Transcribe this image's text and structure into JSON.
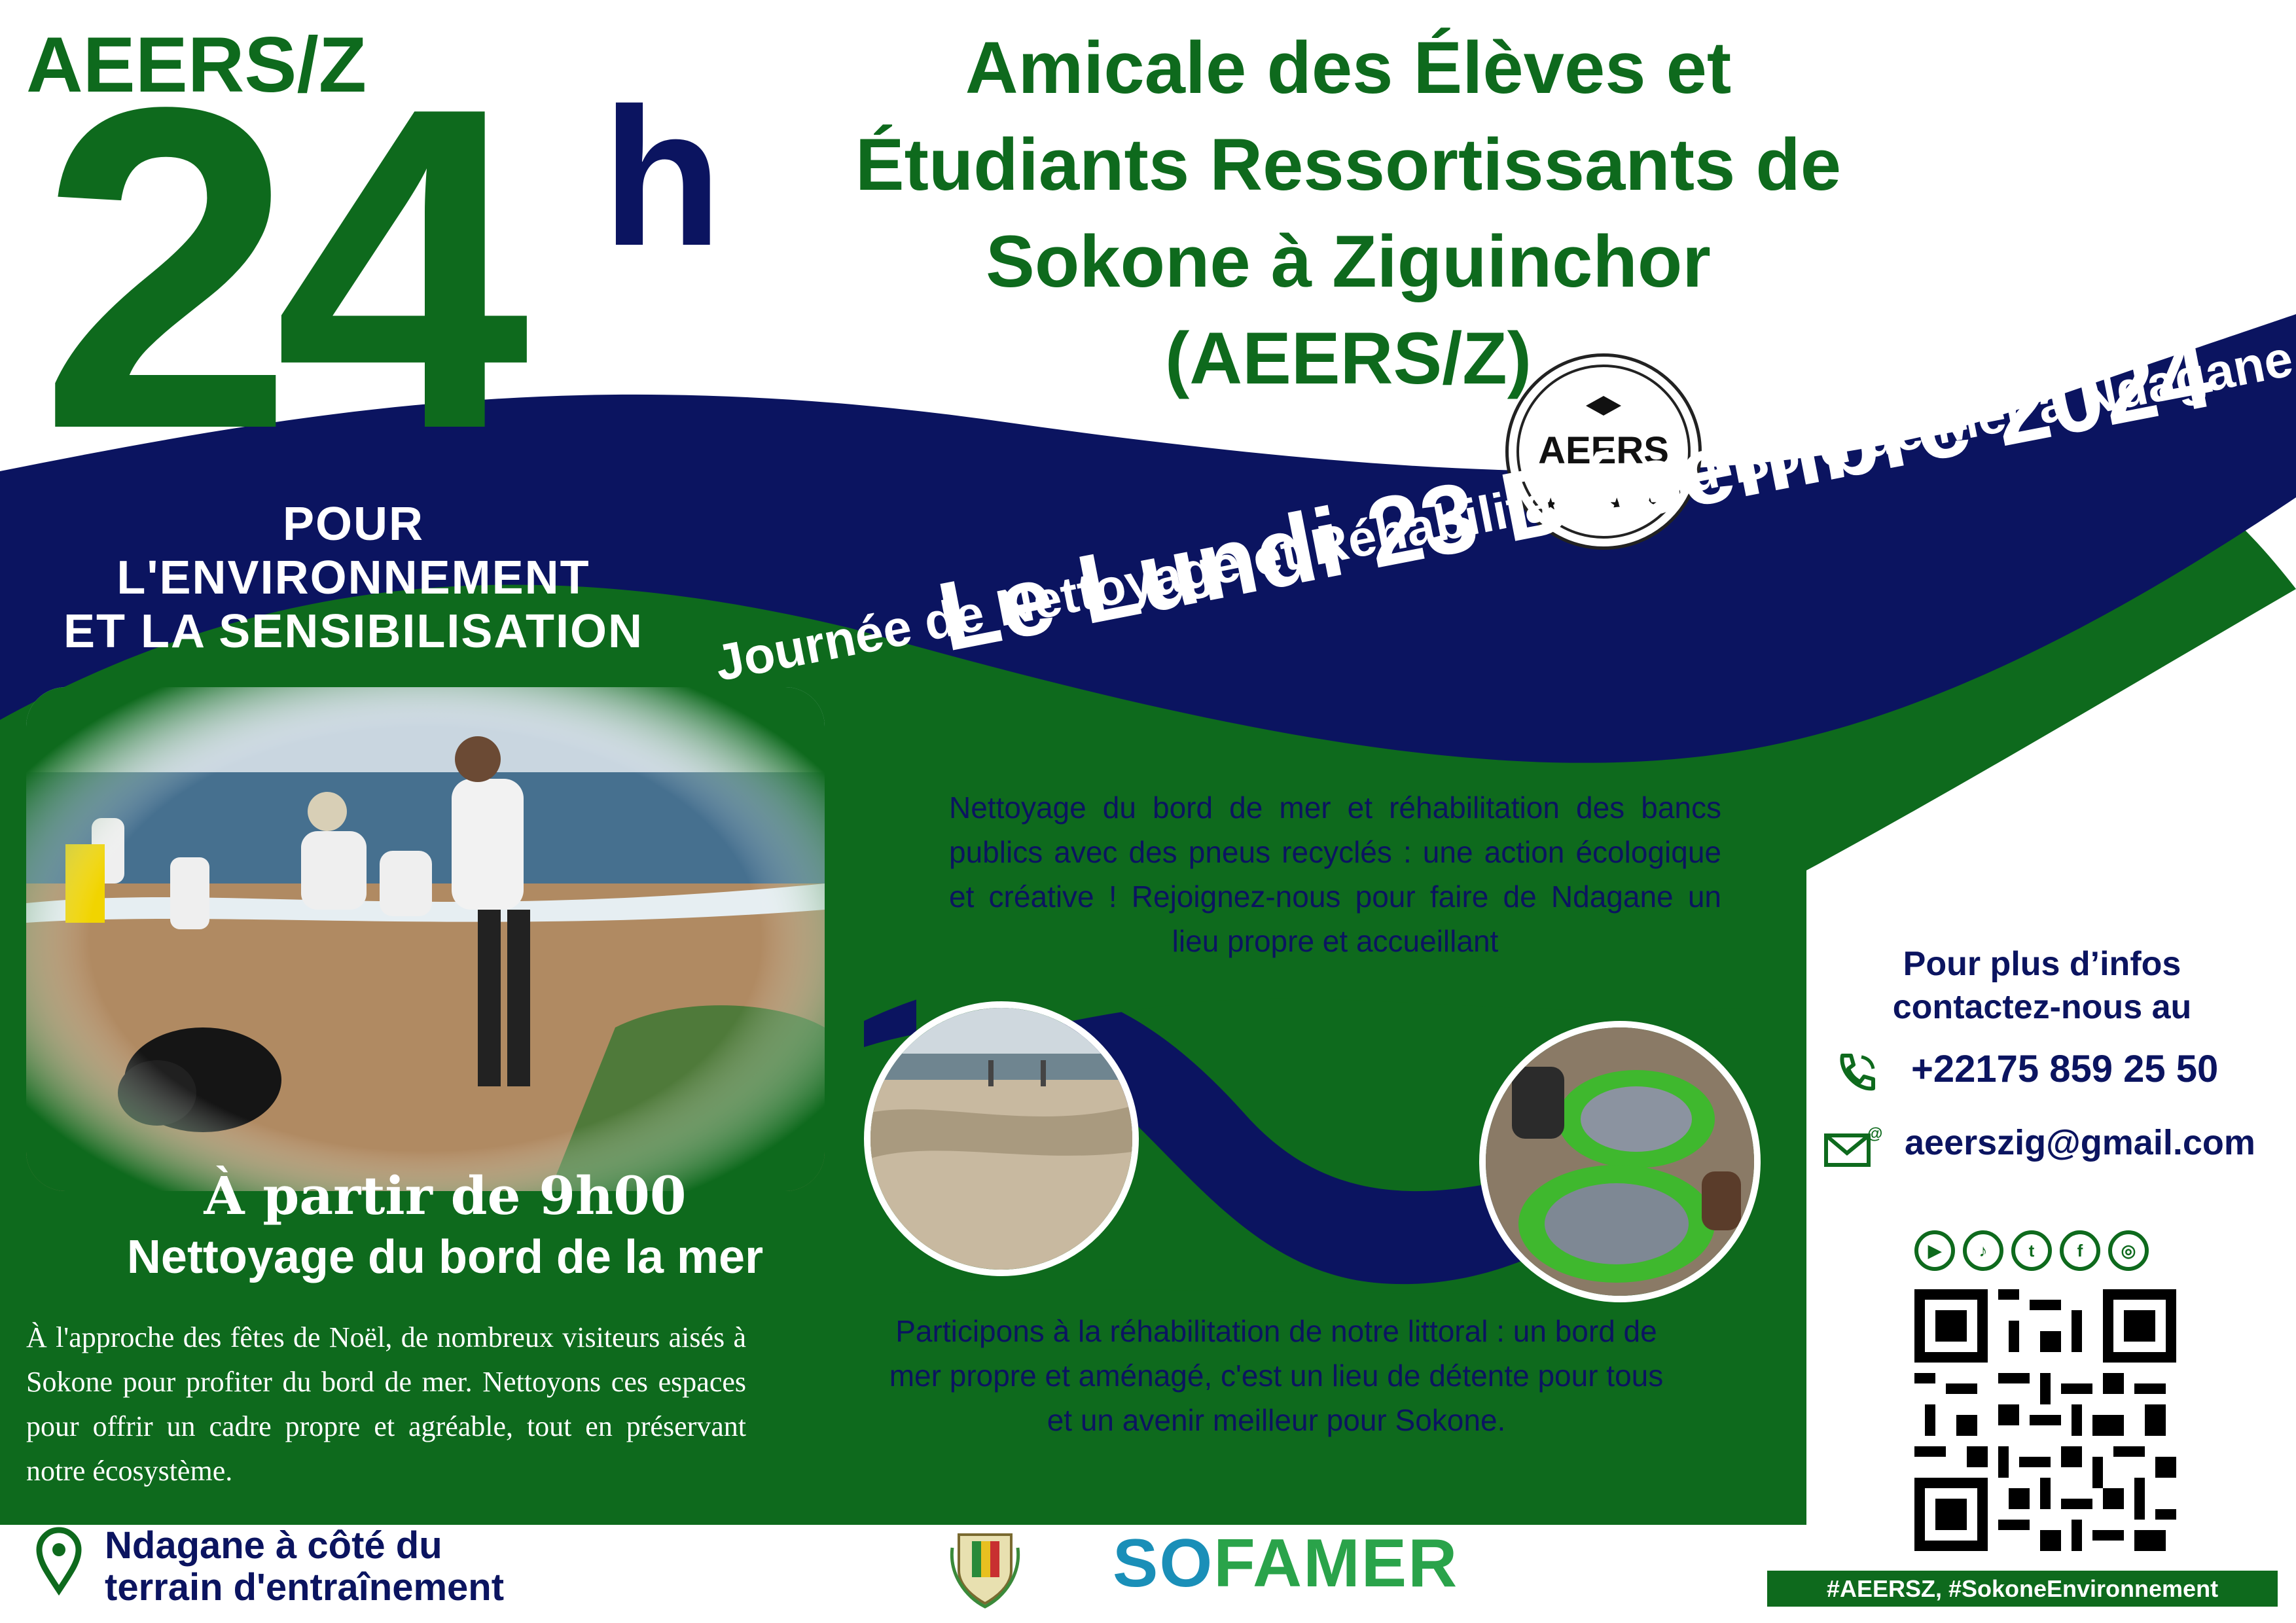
{
  "header": {
    "org_short": "AEERS/Z",
    "big_number": "24",
    "big_unit": "h",
    "tagline_line1": "POUR L'ENVIRONNEMENT",
    "tagline_line2": "ET LA SENSIBILISATION",
    "org_full_line1": "Amicale des Élèves et",
    "org_full_line2": "Étudiants Ressortissants de",
    "org_full_line3": "Sokone à Ziguinchor (AEERS/Z)"
  },
  "logo": {
    "text": "AEERS",
    "ring_text": "Amicale des Élèves et Etudiants Ressortissants de Sokone",
    "stars": "★ ★ ★ ★"
  },
  "event": {
    "date": "Le Lundi 23 Décembre 2024",
    "subtitle": "Journée de Nettoyage et Réhabilitation du Bord de Mer à Ndagane",
    "time": "À partir de 9h00",
    "activity": "Nettoyage du bord de la mer"
  },
  "texts": {
    "intro": "À l'approche des fêtes de Noël, de nombreux visiteurs aisés à Sokone pour profiter du bord de mer. Nettoyons ces espaces pour offrir un cadre propre et agréable, tout en préservant notre écosystème.",
    "para1": "Nettoyage du bord de mer et réhabilitation des bancs publics avec des pneus recyclés : une action écologique et créative ! Rejoignez-nous pour faire de Ndagane un lieu propre et accueillant",
    "para2": "Participons à la réhabilitation de notre littoral : un bord de mer propre et aménagé, c'est un lieu de détente pour tous et un avenir meilleur pour Sokone."
  },
  "contact": {
    "title_line1": "Pour plus d’infos",
    "title_line2": "contactez-nous au",
    "phone": "+22175 859 25 50",
    "email": "aeerszig@gmail.com",
    "social_icons": [
      "youtube-icon",
      "tiktok-icon",
      "twitter-icon",
      "facebook-icon",
      "instagram-icon"
    ]
  },
  "footer": {
    "location_line1": "Ndagane à côté du",
    "location_line2": "terrain d'entraînement",
    "sponsor_part1": "SO",
    "sponsor_part2": "FAMER",
    "hashtags": "#AEERSZ, #SokoneEnvironnement"
  },
  "colors": {
    "green": "#0e6a1d",
    "navy": "#0b1460",
    "white": "#ffffff"
  }
}
